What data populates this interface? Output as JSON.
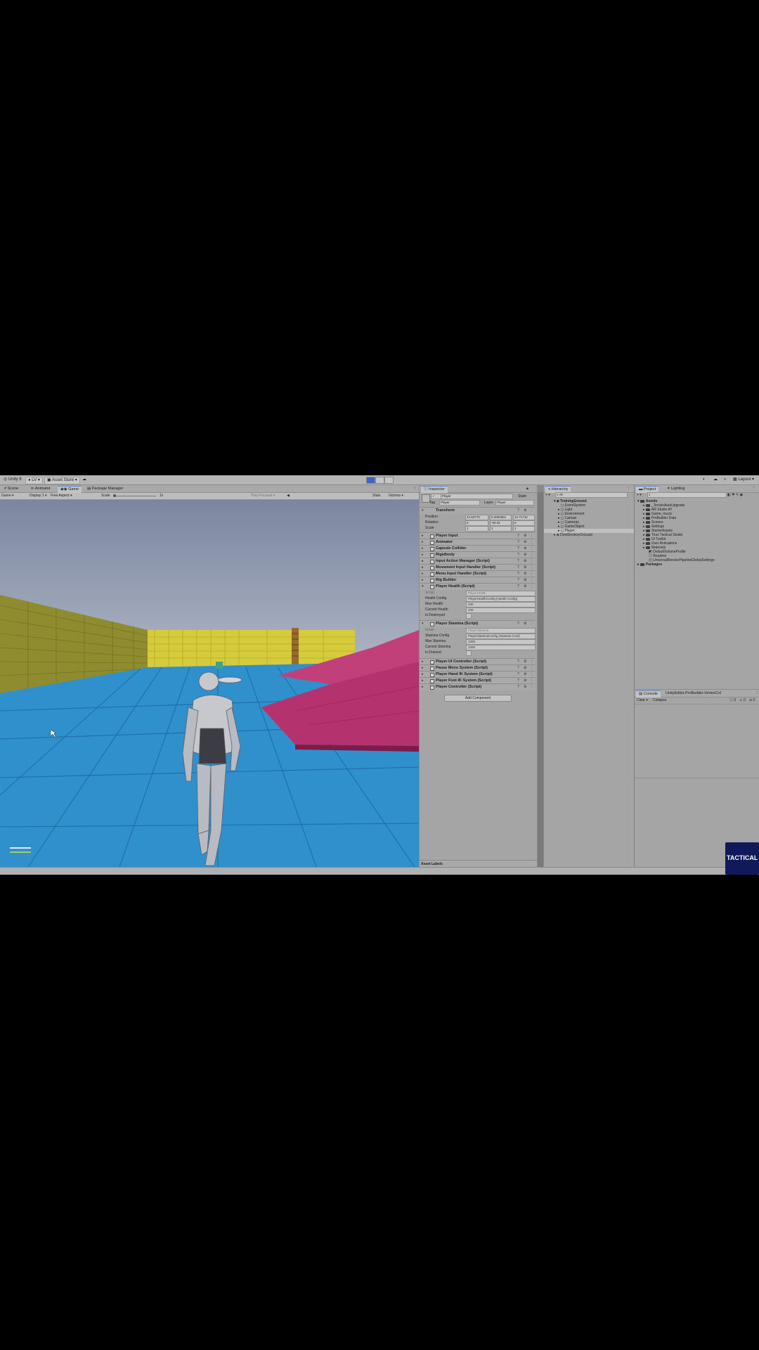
{
  "toolbar": {
    "unity_label": "Unity 6",
    "account_label": "LV",
    "asset_store_label": "Asset Store",
    "layout_label": "Layout"
  },
  "left_tabs": [
    "Scene",
    "Animator",
    "Game",
    "Package Manager"
  ],
  "game_bar": {
    "mode": "Game",
    "display": "Display 1",
    "aspect": "Free Aspect",
    "scale_label": "Scale",
    "scale_value": "1x",
    "play_focused": "Play Focused",
    "stats": "Stats",
    "gizmos": "Gizmos"
  },
  "inspector": {
    "tab": "Inspector",
    "object_name": "Player",
    "static_label": "Static",
    "tag_label": "Tag",
    "tag_value": "Player",
    "layer_label": "Layer",
    "layer_value": "Player",
    "transform": {
      "title": "Transform",
      "position_label": "Position",
      "rotation_label": "Rotation",
      "scale_label": "Scale",
      "position": [
        "44.62770",
        "0.0084551",
        "12.71742"
      ],
      "rotation": [
        "0",
        "-94.02",
        "0"
      ],
      "scale": [
        "1",
        "1",
        "1"
      ]
    },
    "components": [
      "Player Input",
      "Animator",
      "Capsule Collider",
      "Rigidbody",
      "Input Action Manager (Script)",
      "Movement Input Handler (Script)",
      "Menu Input Handler (Script)",
      "Rig Builder",
      "Player Health (Script)"
    ],
    "health": {
      "script_label": "Script",
      "script_value": "PlayerHealth",
      "rows": [
        {
          "label": "Health Config",
          "value": "PlayerHealthConfig (Health Config)"
        },
        {
          "label": "Max Health",
          "value": "200"
        },
        {
          "label": "Current Health",
          "value": "200"
        },
        {
          "label": "Is Destroyed",
          "value": ""
        }
      ]
    },
    "stamina_title": "Player Stamina (Script)",
    "stamina": {
      "script_label": "Script",
      "script_value": "PlayerStamina",
      "rows": [
        {
          "label": "Stamina Config",
          "value": "PlayerStaminaConfig (Stamina Conf)"
        },
        {
          "label": "Max Stamina",
          "value": "1000"
        },
        {
          "label": "Current Stamina",
          "value": "1000"
        },
        {
          "label": "Is Drained",
          "value": ""
        }
      ]
    },
    "components_after": [
      "Player UI Controller (Script)",
      "Pause Menu System (Script)",
      "Player Hand IK System (Script)",
      "Player Foot IK System (Script)",
      "Player Controller (Script)"
    ],
    "add_component": "Add Component",
    "asset_labels": "Asset Labels"
  },
  "hierarchy": {
    "tab": "Hierarchy",
    "search_placeholder": "All",
    "scene": "TrainingGround",
    "items": [
      "EventSystem",
      "Light",
      "Environment",
      "Canvas",
      "Cameras",
      "GameObject",
      "Player"
    ],
    "dont_destroy": "DontDestroyOnLoad"
  },
  "project": {
    "tab": "Project",
    "tab2": "Lighting",
    "assets_label": "Assets",
    "folders": [
      "_TerrainAutoUpgrade",
      "AR Studio AT",
      "Game_music",
      "ProBuilder Data",
      "Scenes",
      "Settings",
      "StarterAssets",
      "Tirax Tactical Studio",
      "UI Toolkit",
      "User Animations",
      "Materials"
    ],
    "files": [
      "DefaultVolumeProfile",
      "Readme",
      "UniversalRenderPipelineGlobalSettings"
    ],
    "packages_label": "Packages"
  },
  "console": {
    "tab": "Console",
    "tab2": "UnityEditor.ProBuilder.VertexCol",
    "clear": "Clear",
    "collapse": "Collapse",
    "counts": [
      "0",
      "0",
      "0"
    ]
  },
  "watermark": "TACTICAL",
  "colors": {
    "sky_top": "#7f8aa0",
    "floor": "#2f8fc8",
    "wall_yellow": "#d3c93a",
    "wall_left": "#8c8a2c",
    "ramp": "#b2336d",
    "accent": "#3b66c4"
  }
}
